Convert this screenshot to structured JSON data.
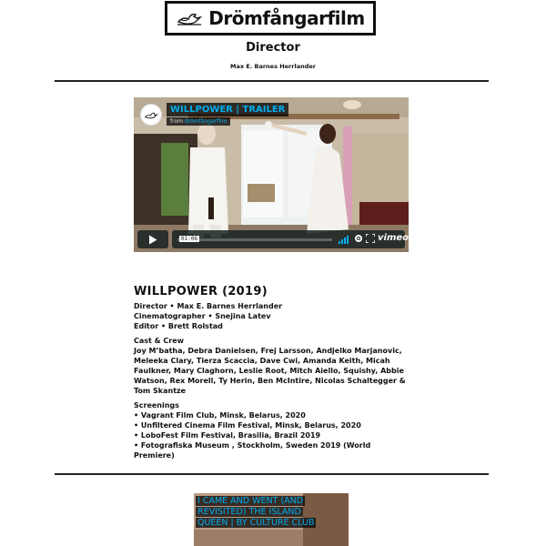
{
  "header": {
    "brand": "Drömfångarfilm",
    "subtitle": "Director",
    "person": "Max E. Barnes Herrlander"
  },
  "video": {
    "title": "WILLPOWER | TRAILER",
    "from_prefix": "from",
    "from_channel": "drömfångarfilm",
    "time": "01:06",
    "player_brand": "vimeo",
    "play_icon": "play-icon",
    "volume_icon": "volume-icon",
    "settings_icon": "gear-icon",
    "fullscreen_icon": "fullscreen-icon",
    "accent_color": "#00adef"
  },
  "film": {
    "title": "WILLPOWER (2019)",
    "credits": [
      "Director • Max E. Barnes Herrlander",
      "Cinematographer • Snejina Latev",
      "Editor • Brett Rolstad"
    ],
    "cast_heading": "Cast & Crew",
    "cast": "Joy M’batha, Debra Danielsen, Frej Larsson, Andjelko Marjanovic, Meleeka Clary, Tierza Scaccia, Dave Cwi, Amanda Keith, Micah Faulkner, Mary Claghorn, Leslie Root, Mitch Aiello, Squishy, Abbie Watson, Rex Morell, Ty Herin, Ben McIntire, Nicolas Schaltegger & Tom Skantze",
    "screenings_heading": "Screenings",
    "screenings": [
      "• Vagrant Film Club, Minsk, Belarus, 2020",
      "• Unfiltered Cinema Film Festival, Minsk, Belarus, 2020",
      "• LoboFest Film Festival, Brasilia, Brazil 2019",
      "• Fotografiska Museum , Stockholm, Sweden 2019 (World Premiere)"
    ]
  },
  "next_video": {
    "title": "I CAME AND WENT (AND REVISITED) THE ISLAND QUEEN | BY CULTURE CLUB"
  }
}
